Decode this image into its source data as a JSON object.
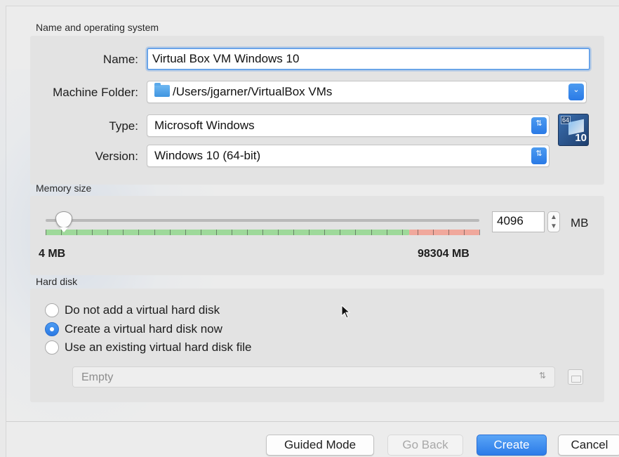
{
  "sections": {
    "name_os": "Name and operating system",
    "memory": "Memory size",
    "hard_disk": "Hard disk"
  },
  "form": {
    "name_label": "Name:",
    "name_value": "Virtual Box VM Windows 10",
    "folder_label": "Machine Folder:",
    "folder_value": "/Users/jgarner/VirtualBox VMs",
    "type_label": "Type:",
    "type_value": "Microsoft Windows",
    "version_label": "Version:",
    "version_value": "Windows 10 (64-bit)",
    "os_badge_top": "64",
    "os_badge_bottom": "10"
  },
  "memory": {
    "value": "4096",
    "unit": "MB",
    "min_label": "4 MB",
    "max_label": "98304 MB",
    "slider_fraction": 0.042
  },
  "hard_disk": {
    "options": [
      {
        "label": "Do not add a virtual hard disk",
        "checked": false
      },
      {
        "label": "Create a virtual hard disk now",
        "checked": true
      },
      {
        "label": "Use an existing virtual hard disk file",
        "checked": false
      }
    ],
    "file_select_value": "Empty"
  },
  "buttons": {
    "guided_mode": "Guided Mode",
    "go_back": "Go Back",
    "create": "Create",
    "cancel": "Cancel"
  },
  "colors": {
    "accent": "#2b7be8",
    "scale_green": "#9ed99a",
    "scale_red": "#f0a89c"
  },
  "icons": {
    "folder": "folder-icon",
    "os_type": "windows-10-64-icon",
    "disk_file": "choose-disk-file-icon"
  }
}
